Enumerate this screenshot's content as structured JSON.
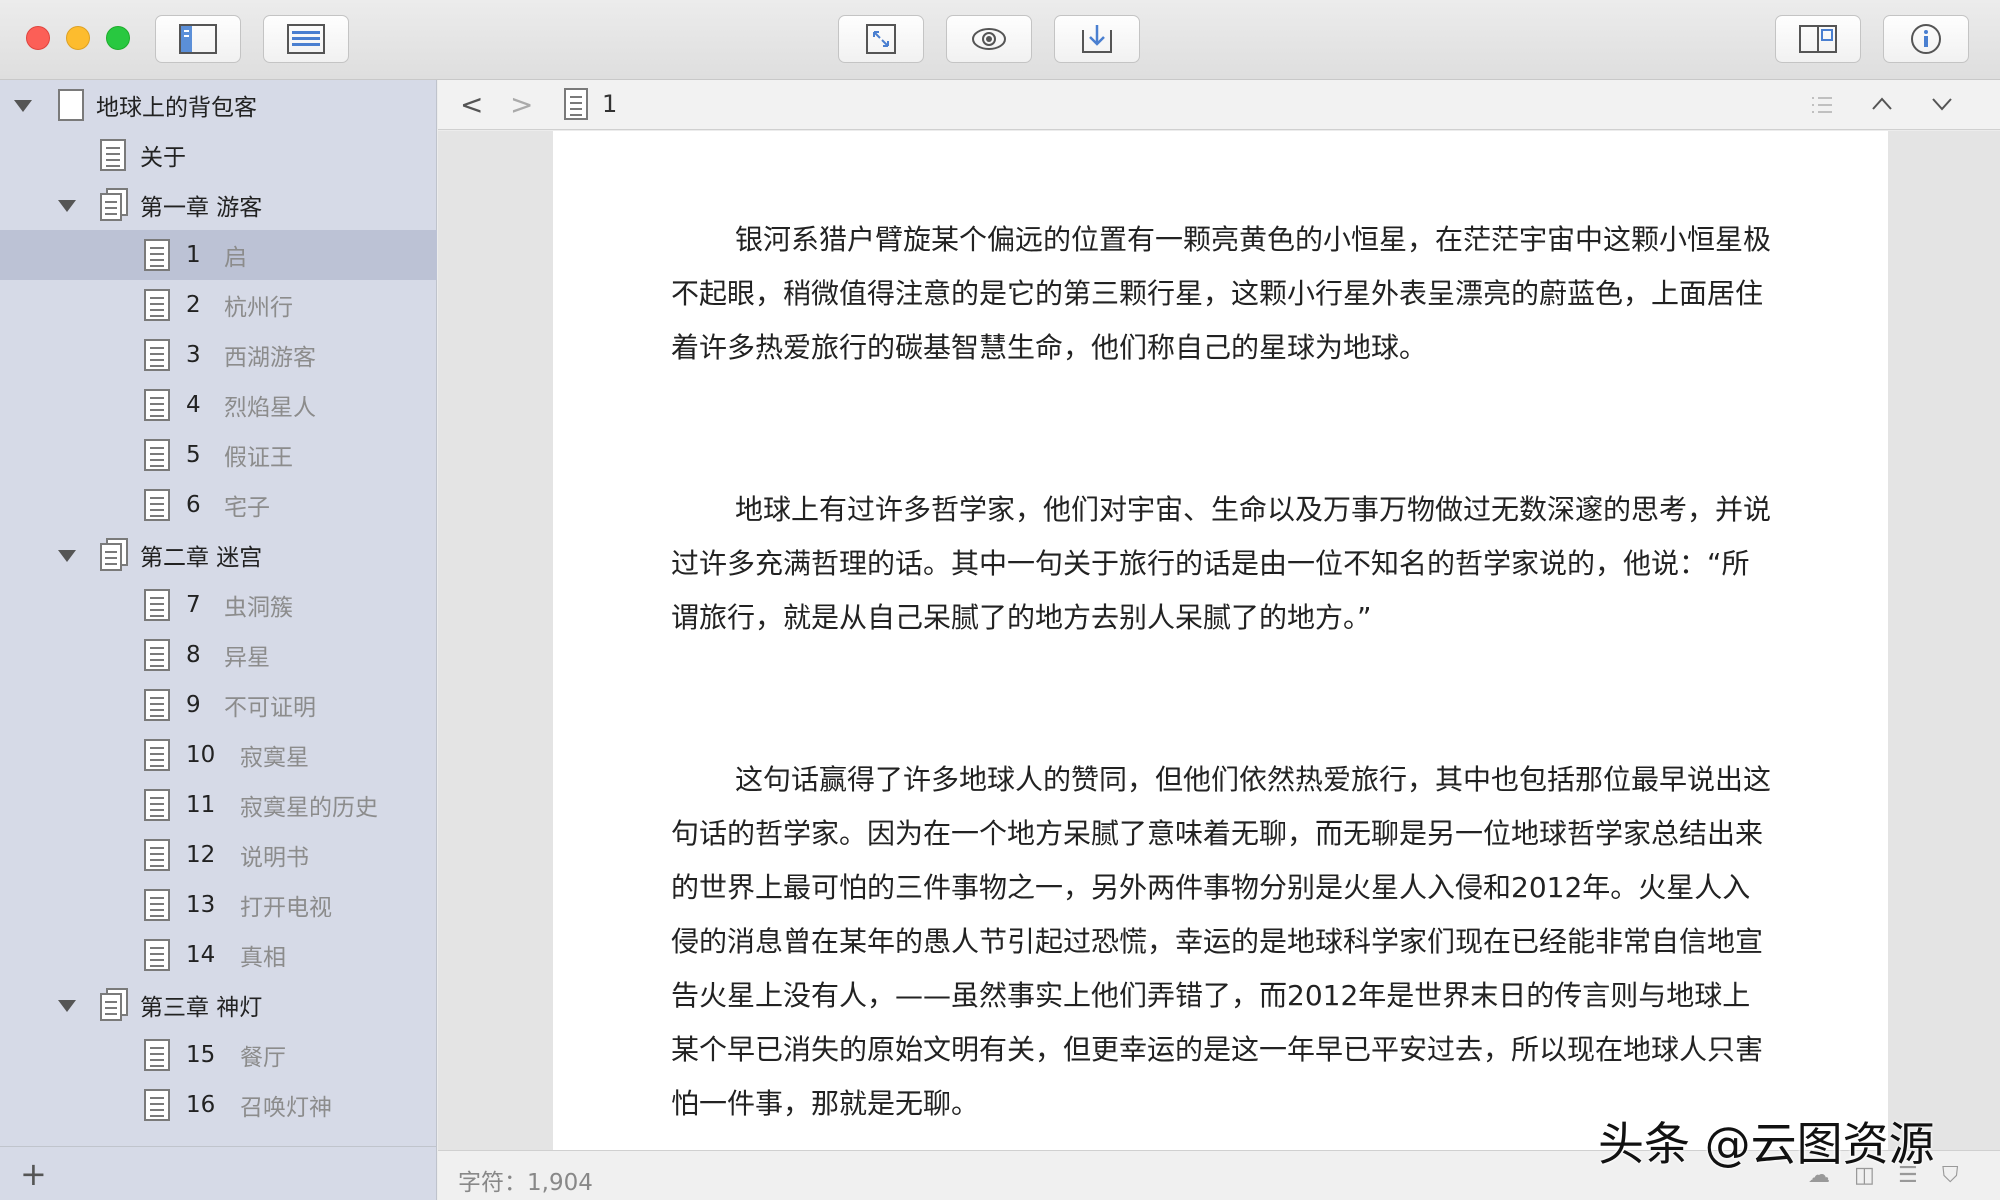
{
  "sidebar": {
    "items": [
      {
        "kind": "root",
        "title": "地球上的背包客"
      },
      {
        "kind": "doc",
        "num": "",
        "title": "关于"
      },
      {
        "kind": "chapter",
        "title": "第一章 游客"
      },
      {
        "kind": "doc",
        "num": "1",
        "title": "启",
        "selected": true
      },
      {
        "kind": "doc",
        "num": "2",
        "title": "杭州行"
      },
      {
        "kind": "doc",
        "num": "3",
        "title": "西湖游客"
      },
      {
        "kind": "doc",
        "num": "4",
        "title": "烈焰星人"
      },
      {
        "kind": "doc",
        "num": "5",
        "title": "假证王"
      },
      {
        "kind": "doc",
        "num": "6",
        "title": "宅子"
      },
      {
        "kind": "chapter",
        "title": "第二章 迷宫"
      },
      {
        "kind": "doc",
        "num": "7",
        "title": "虫洞簇"
      },
      {
        "kind": "doc",
        "num": "8",
        "title": "异星"
      },
      {
        "kind": "doc",
        "num": "9",
        "title": "不可证明"
      },
      {
        "kind": "doc",
        "num": "10",
        "title": "寂寞星"
      },
      {
        "kind": "doc",
        "num": "11",
        "title": "寂寞星的历史"
      },
      {
        "kind": "doc",
        "num": "12",
        "title": "说明书"
      },
      {
        "kind": "doc",
        "num": "13",
        "title": "打开电视"
      },
      {
        "kind": "doc",
        "num": "14",
        "title": "真相"
      },
      {
        "kind": "chapter",
        "title": "第三章 神灯"
      },
      {
        "kind": "doc",
        "num": "15",
        "title": "餐厅"
      },
      {
        "kind": "doc",
        "num": "16",
        "title": "召唤灯神"
      }
    ],
    "add_label": "+"
  },
  "nav": {
    "back": "<",
    "forward": ">",
    "breadcrumb": "1"
  },
  "document": {
    "paragraphs": [
      "银河系猎户臂旋某个偏远的位置有一颗亮黄色的小恒星，在茫茫宇宙中这颗小恒星极不起眼，稍微值得注意的是它的第三颗行星，这颗小行星外表呈漂亮的蔚蓝色，上面居住着许多热爱旅行的碳基智慧生命，他们称自己的星球为地球。",
      "地球上有过许多哲学家，他们对宇宙、生命以及万事万物做过无数深邃的思考，并说过许多充满哲理的话。其中一句关于旅行的话是由一位不知名的哲学家说的，他说：“所谓旅行，就是从自己呆腻了的地方去别人呆腻了的地方。”",
      "这句话赢得了许多地球人的赞同，但他们依然热爱旅行，其中也包括那位最早说出这句话的哲学家。因为在一个地方呆腻了意味着无聊，而无聊是另一位地球哲学家总结出来的世界上最可怕的三件事物之一，另外两件事物分别是火星人入侵和2012年。火星人入侵的消息曾在某年的愚人节引起过恐慌，幸运的是地球科学家们现在已经能非常自信地宣告火星上没有人，——虽然事实上他们弄错了，而2012年是世界末日的传言则与地球上某个早已消失的原始文明有关，但更幸运的是这一年早已平安过去，所以现在地球人只害怕一件事，那就是无聊。"
    ]
  },
  "footer": {
    "word_count": "字符：1,904"
  },
  "watermark": "头条 @云图资源",
  "colors": {
    "sidebar_bg": "#d6dae7",
    "selected_row": "#bcc2d5",
    "close": "#fc5f57",
    "minimize": "#fdbc2e",
    "zoom": "#28c840"
  }
}
